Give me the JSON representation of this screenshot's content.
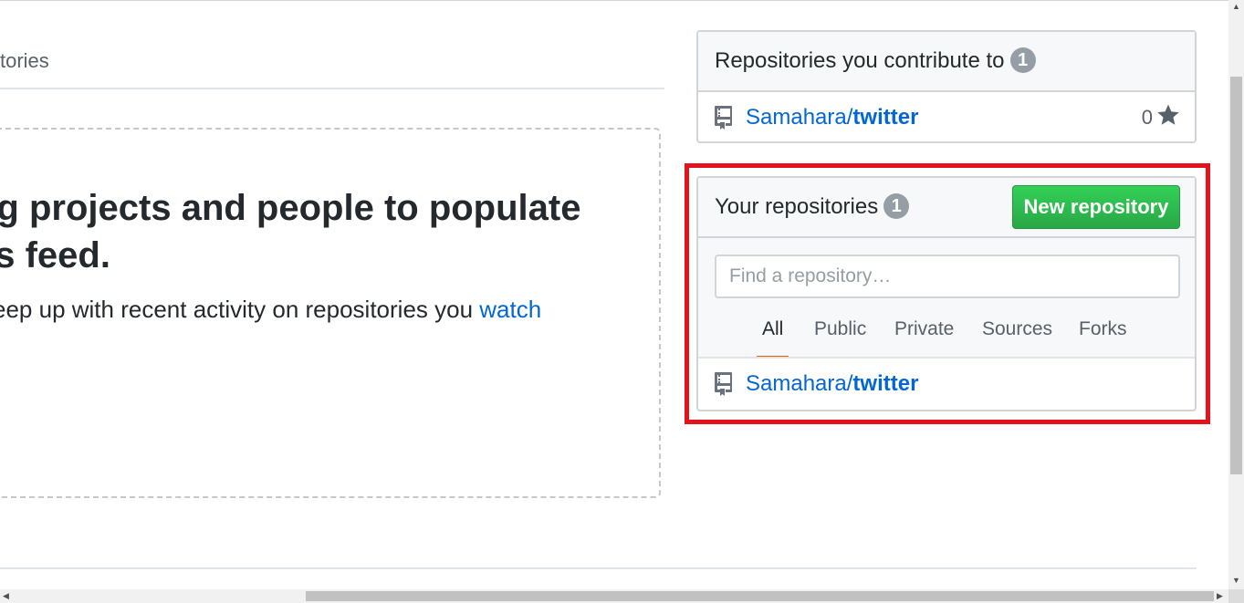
{
  "main": {
    "tab_partial": "tories",
    "blankslate": {
      "heading_line1": "ng projects and people to populate",
      "heading_line2": "vs feed.",
      "text_prefix": "eep up with recent activity on repositories you ",
      "text_link": "watch"
    }
  },
  "contribute_box": {
    "title": "Repositories you contribute to",
    "count": "1",
    "repos": [
      {
        "owner": "Samahara/",
        "name": "twitter",
        "stars": "0"
      }
    ]
  },
  "your_repos_box": {
    "title": "Your repositories",
    "count": "1",
    "new_button": "New repository",
    "search_placeholder": "Find a repository…",
    "filters": [
      "All",
      "Public",
      "Private",
      "Sources",
      "Forks"
    ],
    "selected_filter": "All",
    "repos": [
      {
        "owner": "Samahara/",
        "name": "twitter"
      }
    ]
  },
  "colors": {
    "link": "#0366d6",
    "highlight": "#e3121b",
    "button_green": "#28a745",
    "tab_underline": "#e36209"
  },
  "icons": [
    "repo-icon",
    "star-icon"
  ]
}
